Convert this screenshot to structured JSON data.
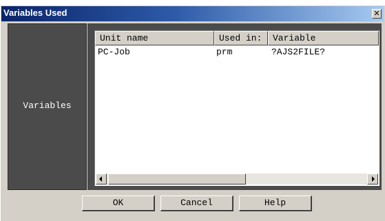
{
  "window": {
    "title": "Variables Used",
    "close_glyph": "✕"
  },
  "left_panel": {
    "label": "Variables"
  },
  "table": {
    "columns": [
      "Unit name",
      "Used in:",
      "Variable"
    ],
    "rows": [
      [
        "PC-Job",
        "prm",
        "?AJS2FILE?"
      ]
    ]
  },
  "scrollbar": {
    "icons": [
      "arrow-left-icon",
      "arrow-right-icon"
    ]
  },
  "buttons": {
    "ok": "OK",
    "cancel": "Cancel",
    "help": "Help"
  },
  "colors": {
    "titlebar_start": "#0a246a",
    "titlebar_end": "#a6caf0",
    "dialog_face": "#d4d0c8",
    "panel_dark": "#4b4b4b"
  }
}
